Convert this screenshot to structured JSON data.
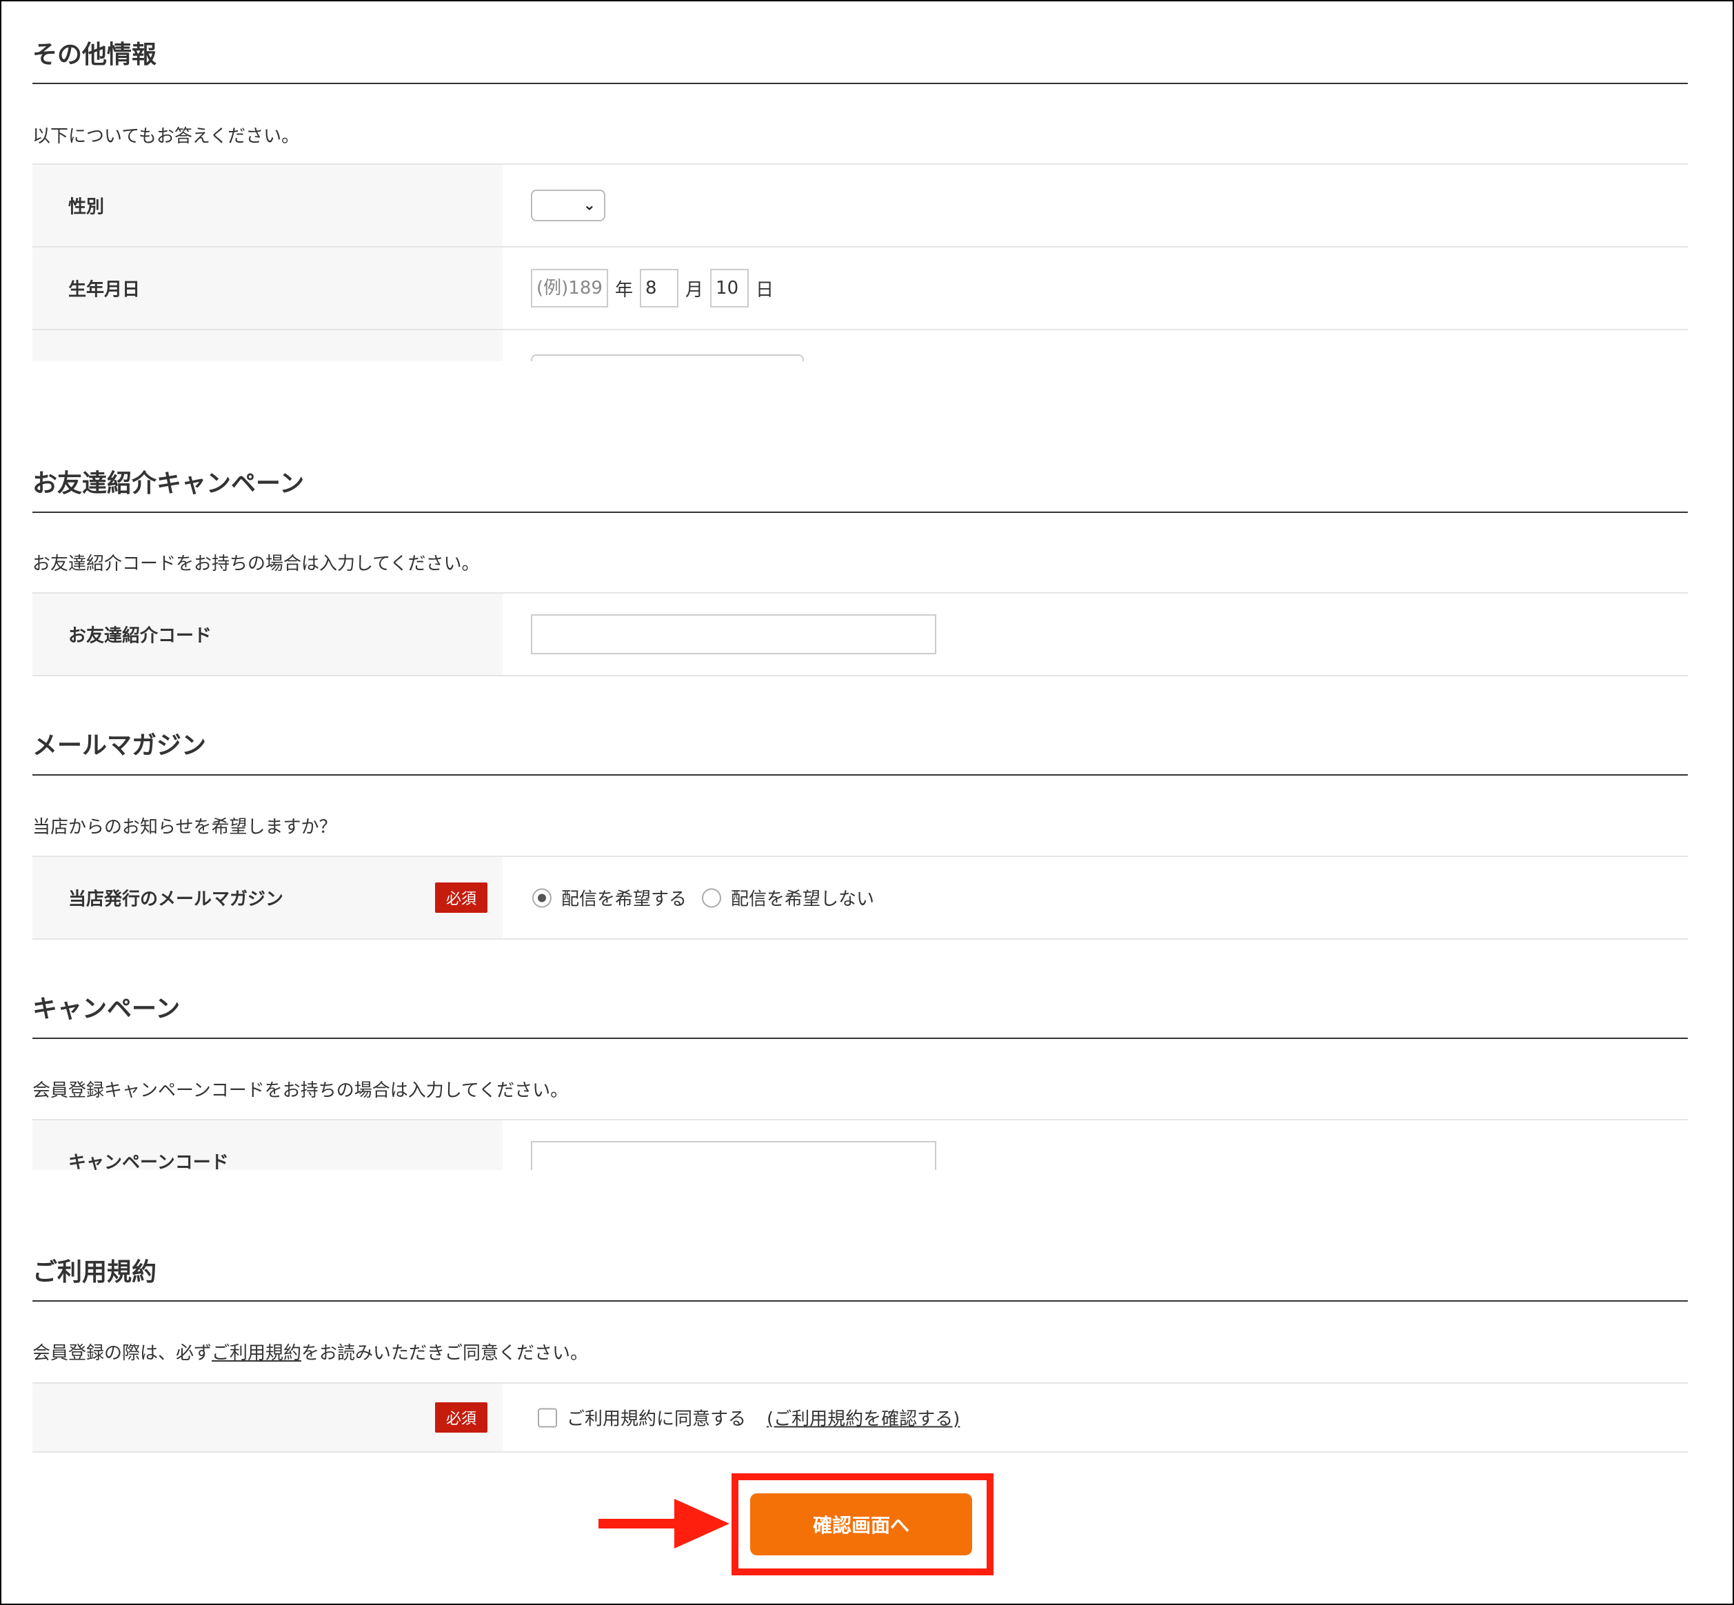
{
  "sections": {
    "other": {
      "title": "その他情報",
      "description": "以下についてもお答えください。",
      "gender_label": "性別",
      "gender_value": "",
      "birthday_label": "生年月日",
      "year_placeholder": "(例)189",
      "year_unit": "年",
      "month_value": "8",
      "month_unit": "月",
      "day_value": "10",
      "day_unit": "日"
    },
    "referral": {
      "title": "お友達紹介キャンペーン",
      "description": "お友達紹介コードをお持ちの場合は入力してください。",
      "code_label": "お友達紹介コード",
      "code_value": ""
    },
    "newsletter": {
      "title": "メールマガジン",
      "description": "当店からのお知らせを希望しますか？",
      "field_label": "当店発行のメールマガジン",
      "required_badge": "必須",
      "option_yes": "配信を希望する",
      "option_no": "配信を希望しない",
      "selected": "配信を希望する"
    },
    "campaign": {
      "title": "キャンペーン",
      "description": "会員登録キャンペーンコードをお持ちの場合は入力してください。",
      "code_label": "キャンペーンコード",
      "code_value": ""
    },
    "terms": {
      "title": "ご利用規約",
      "description_before": "会員登録の際は、必ず",
      "description_link": "ご利用規約",
      "description_after": "をお読みいただきご同意ください。",
      "required_badge": "必須",
      "agree_label": "ご利用規約に同意する",
      "confirm_link": "(ご利用規約を確認する)",
      "agreed": false
    }
  },
  "submit": {
    "label": "確認画面へ"
  },
  "colors": {
    "button": "#f47108",
    "highlight": "#ff1f0f",
    "required_badge": "#c51c0e",
    "label_bg": "#f7f7f7"
  }
}
